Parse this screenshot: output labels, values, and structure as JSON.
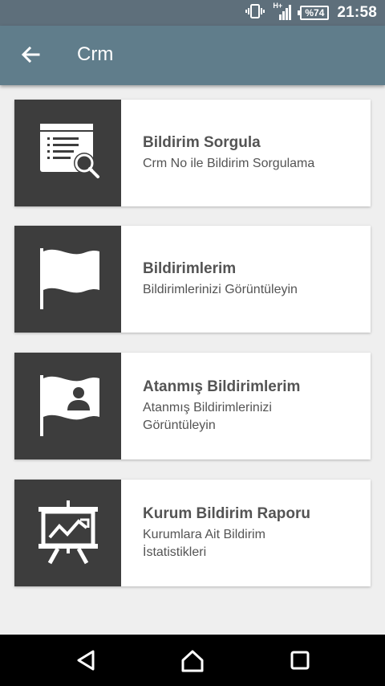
{
  "status_bar": {
    "battery": "%74",
    "time": "21:58",
    "network": "H+",
    "icons": [
      "vibrate-icon",
      "signal-icon",
      "battery-icon"
    ]
  },
  "app_bar": {
    "title": "Crm",
    "back_icon": "arrow-back-icon"
  },
  "menu": [
    {
      "title": "Bildirim Sorgula",
      "subtitle": "Crm No ile Bildirim Sorgulama",
      "icon": "document-search-icon"
    },
    {
      "title": "Bildirimlerim",
      "subtitle": "Bildirimlerinizi Görüntüleyin",
      "icon": "flag-icon"
    },
    {
      "title": "Atanmış Bildirimlerim",
      "subtitle": "Atanmış Bildirimlerinizi Görüntüleyin",
      "icon": "flag-user-icon"
    },
    {
      "title": "Kurum Bildirim Raporu",
      "subtitle": "Kurumlara Ait Bildirim İstatistikleri",
      "icon": "presentation-chart-icon"
    }
  ],
  "nav_bar": {
    "buttons": [
      "back-triangle-icon",
      "home-icon",
      "recents-icon"
    ]
  },
  "colors": {
    "app_bar": "#607d8b",
    "status_bar": "#5e6f7b",
    "icon_tile": "#3d3d3d",
    "background": "#efefef",
    "text": "#545454"
  }
}
